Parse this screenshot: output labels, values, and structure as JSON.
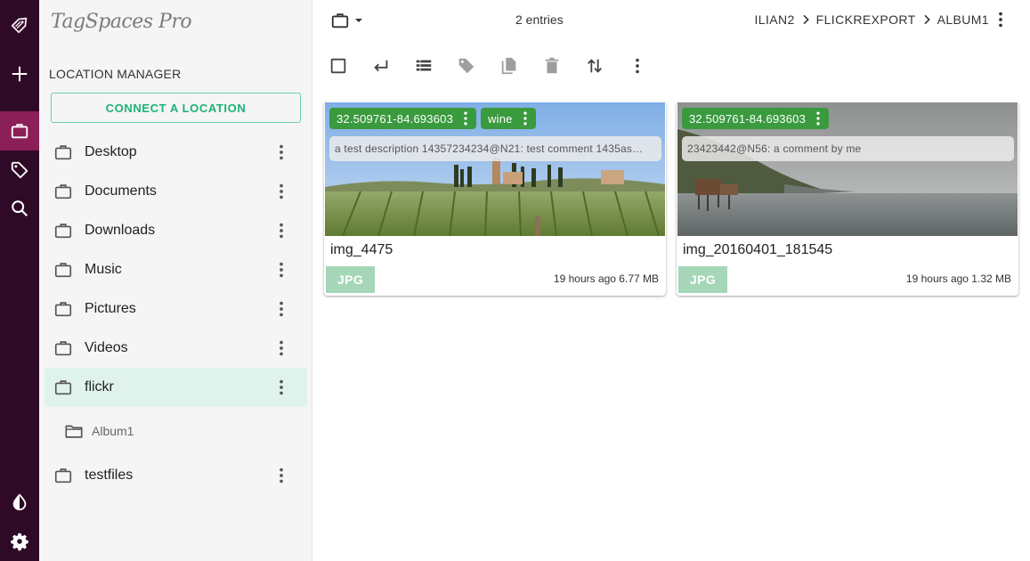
{
  "app": {
    "logo": "TagSpaces Pro"
  },
  "colors": {
    "rail": "#2f0a26",
    "rail_active": "#8b1f57",
    "accent": "#1db27a",
    "tag": "#3a9a3e",
    "active_row": "#dff3ec",
    "ext_badge": "#a5d6b8"
  },
  "rail": {
    "items": [
      {
        "icon": "tagspaces-logo-icon"
      },
      {
        "icon": "plus-icon"
      },
      {
        "icon": "briefcase-icon",
        "active": true
      },
      {
        "icon": "tag-icon"
      },
      {
        "icon": "search-icon"
      },
      {
        "icon": "theme-toggle-icon"
      },
      {
        "icon": "gear-icon"
      }
    ]
  },
  "sidebar": {
    "section_title": "LOCATION MANAGER",
    "connect_button": "CONNECT A LOCATION",
    "locations": [
      {
        "label": "Desktop"
      },
      {
        "label": "Documents"
      },
      {
        "label": "Downloads"
      },
      {
        "label": "Music"
      },
      {
        "label": "Pictures"
      },
      {
        "label": "Videos"
      },
      {
        "label": "flickr",
        "active": true
      },
      {
        "label": "testfiles"
      }
    ],
    "subfolders": [
      {
        "label": "Album1"
      }
    ]
  },
  "main": {
    "entries_count": "2 entries",
    "breadcrumb": [
      "ILIAN2",
      "FLICKREXPORT",
      "ALBUM1"
    ],
    "toolbar": [
      "select-all-checkbox-icon",
      "parent-folder-icon",
      "list-view-icon",
      "tag-icon",
      "copy-icon",
      "delete-icon",
      "sort-icon",
      "more-vertical-icon"
    ],
    "files": [
      {
        "name": "img_4475",
        "tags": [
          "32.509761-84.693603",
          "wine"
        ],
        "description": "a test description 14357234234@N21: test comment 1435as…",
        "extension": "JPG",
        "meta": "19 hours ago 6.77 MB"
      },
      {
        "name": "img_20160401_181545",
        "tags": [
          "32.509761-84.693603"
        ],
        "description": "23423442@N56: a comment by me",
        "extension": "JPG",
        "meta": "19 hours ago 1.32 MB"
      }
    ]
  }
}
